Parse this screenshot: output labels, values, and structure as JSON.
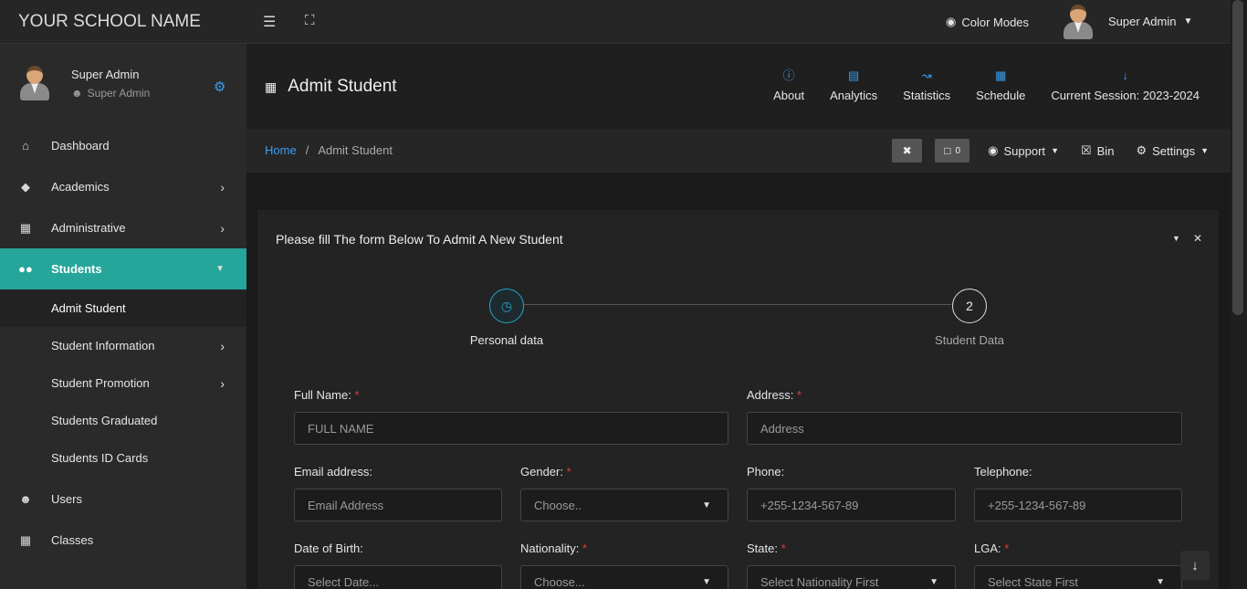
{
  "brand": "YOUR SCHOOL NAME",
  "user": {
    "name": "Super Admin",
    "role": "Super Admin"
  },
  "topbar": {
    "color_modes": "Color Modes",
    "user_name": "Super Admin"
  },
  "sidebar": {
    "items": [
      {
        "label": "Dashboard",
        "icon": "home-icon"
      },
      {
        "label": "Academics",
        "icon": "graduation-cap-icon"
      },
      {
        "label": "Administrative",
        "icon": "building-icon"
      },
      {
        "label": "Students",
        "icon": "users-icon"
      }
    ],
    "sub_items": [
      {
        "label": "Admit Student"
      },
      {
        "label": "Student Information"
      },
      {
        "label": "Student Promotion"
      },
      {
        "label": "Students Graduated"
      },
      {
        "label": "Students ID Cards"
      }
    ],
    "after_items": [
      {
        "label": "Users"
      },
      {
        "label": "Classes"
      }
    ]
  },
  "page": {
    "title": "Admit Student",
    "links": [
      {
        "label": "About"
      },
      {
        "label": "Analytics"
      },
      {
        "label": "Statistics"
      },
      {
        "label": "Schedule"
      },
      {
        "label": "Current Session: 2023-2024"
      }
    ]
  },
  "breadcrumb": {
    "home": "Home",
    "sep": "/",
    "current": "Admit Student"
  },
  "tools": {
    "messages_count": "0",
    "support": "Support",
    "bin": "Bin",
    "settings": "Settings"
  },
  "card": {
    "title": "Please fill The form Below To Admit A New Student",
    "steps": [
      {
        "label": "Personal data"
      },
      {
        "number": "2",
        "label": "Student Data"
      }
    ]
  },
  "form": {
    "full_name": {
      "label": "Full Name:",
      "placeholder": "FULL NAME"
    },
    "address": {
      "label": "Address:",
      "placeholder": "Address"
    },
    "email": {
      "label": "Email address:",
      "placeholder": "Email Address"
    },
    "gender": {
      "label": "Gender:",
      "value": "Choose.."
    },
    "phone": {
      "label": "Phone:",
      "placeholder": "+255-1234-567-89"
    },
    "telephone": {
      "label": "Telephone:",
      "placeholder": "+255-1234-567-89"
    },
    "dob": {
      "label": "Date of Birth:",
      "placeholder": "Select Date..."
    },
    "nationality": {
      "label": "Nationality:",
      "value": "Choose..."
    },
    "state": {
      "label": "State:",
      "value": "Select Nationality First"
    },
    "lga": {
      "label": "LGA:",
      "value": "Select State First"
    }
  },
  "colors": {
    "accent": "#26a69a",
    "link": "#3b9ef0",
    "required": "#e03b3b"
  }
}
